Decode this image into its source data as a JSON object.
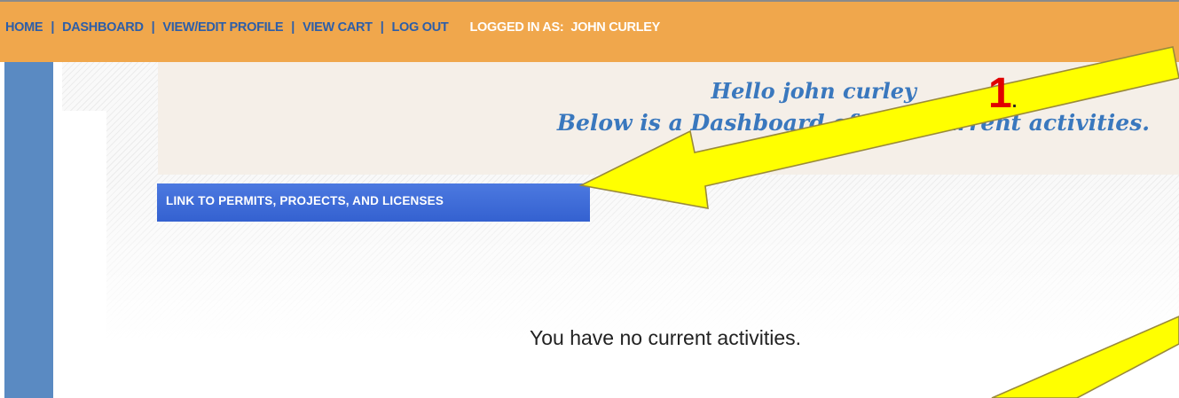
{
  "nav": {
    "home": "HOME",
    "dashboard": "DASHBOARD",
    "profile": "VIEW/EDIT PROFILE",
    "cart": "VIEW CART",
    "logout": "LOG OUT",
    "separator": "|",
    "logged_in_label": "LOGGED IN AS:",
    "user_name": "JOHN CURLEY"
  },
  "greeting": {
    "line1": "Hello john curley",
    "line2": "Below is a Dashboard of your current activities."
  },
  "permits_button_label": "LINK TO PERMITS, PROJECTS, AND LICENSES",
  "empty_message": "You have no current activities.",
  "annotation": {
    "step_number": "1",
    "period": ".",
    "arrow_color": "#ffff00"
  },
  "colors": {
    "nav_bg": "#f0a74c",
    "nav_link": "#2d5ea8",
    "button_bg": "#3d6ad8",
    "greeting_text": "#3a78be",
    "sidebar": "#5a8ac2",
    "step_red": "#e00000"
  }
}
